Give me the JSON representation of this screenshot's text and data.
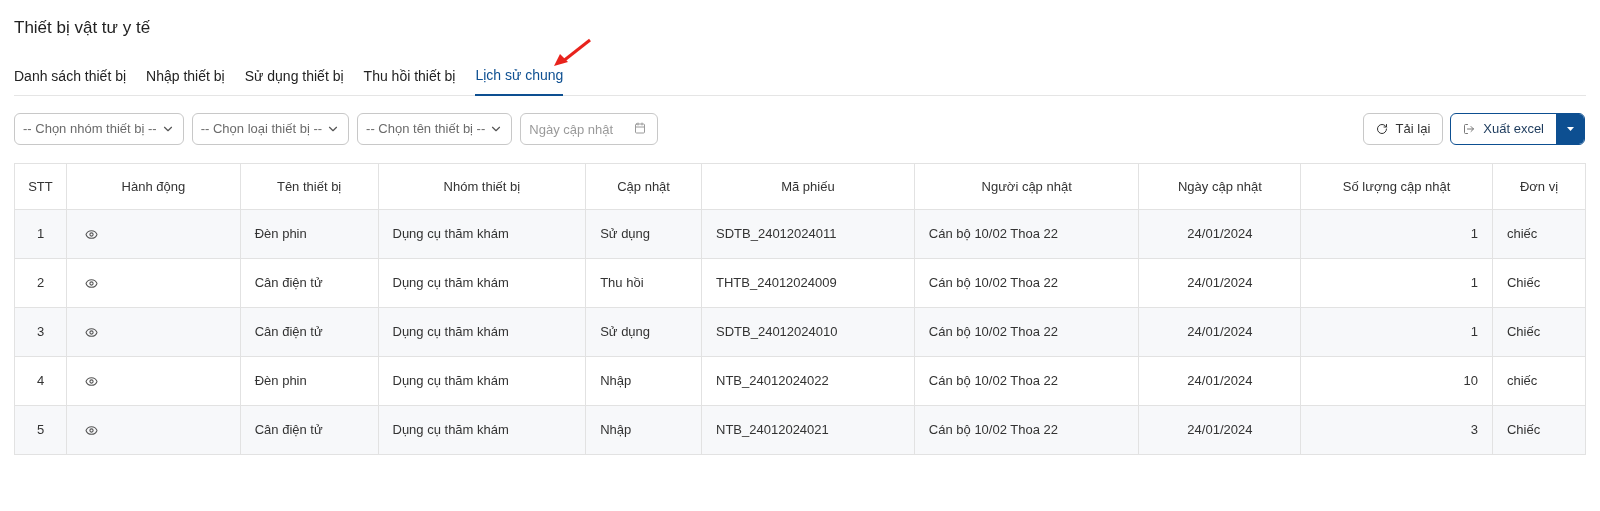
{
  "title": "Thiết bị vật tư y tế",
  "tabs": [
    {
      "label": "Danh sách thiết bị",
      "selected": false
    },
    {
      "label": "Nhập thiết bị",
      "selected": false
    },
    {
      "label": "Sử dụng thiết bị",
      "selected": false
    },
    {
      "label": "Thu hồi thiết bị",
      "selected": false
    },
    {
      "label": "Lịch sử chung",
      "selected": true
    }
  ],
  "filters": [
    {
      "kind": "select",
      "value": "-- Chọn nhóm thiết bị --"
    },
    {
      "kind": "select",
      "value": "-- Chọn loại thiết bị --"
    },
    {
      "kind": "select",
      "value": "-- Chọn tên thiết bị --"
    },
    {
      "kind": "date",
      "placeholder": "Ngày cập nhật"
    }
  ],
  "buttons": {
    "reload": "Tải lại",
    "export": "Xuất excel"
  },
  "table": {
    "columns": [
      "STT",
      "Hành động",
      "Tên thiết bị",
      "Nhóm thiết bị",
      "Cập nhật",
      "Mã phiếu",
      "Người cập nhật",
      "Ngày cập nhật",
      "Số lượng cập nhật",
      "Đơn vị"
    ],
    "rows": [
      [
        "1",
        "",
        "Đèn phin",
        "Dụng cụ thăm khám",
        "Sử dụng",
        "SDTB_24012024011",
        "Cán bộ 10/02 Thoa 22",
        "24/01/2024",
        "1",
        "chiếc"
      ],
      [
        "2",
        "",
        "Cân điện tử",
        "Dụng cụ thăm khám",
        "Thu hồi",
        "THTB_24012024009",
        "Cán bộ 10/02 Thoa 22",
        "24/01/2024",
        "1",
        "Chiếc"
      ],
      [
        "3",
        "",
        "Cân điện tử",
        "Dụng cụ thăm khám",
        "Sử dụng",
        "SDTB_24012024010",
        "Cán bộ 10/02 Thoa 22",
        "24/01/2024",
        "1",
        "Chiếc"
      ],
      [
        "4",
        "",
        "Đèn phin",
        "Dụng cụ thăm khám",
        "Nhập",
        "NTB_24012024022",
        "Cán bộ 10/02 Thoa 22",
        "24/01/2024",
        "10",
        "chiếc"
      ],
      [
        "5",
        "",
        "Cân điện tử",
        "Dụng cụ thăm khám",
        "Nhập",
        "NTB_24012024021",
        "Cán bộ 10/02 Thoa 22",
        "24/01/2024",
        "3",
        "Chiếc"
      ]
    ]
  }
}
